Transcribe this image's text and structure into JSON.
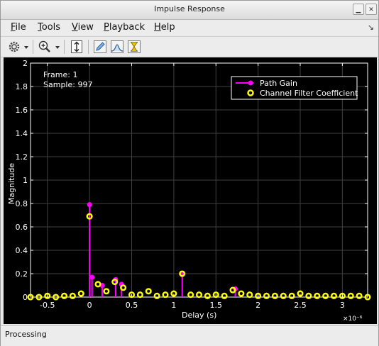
{
  "window": {
    "title": "Impulse Response",
    "minimize_icon": "minimize-icon",
    "close_icon": "close-icon"
  },
  "menubar": {
    "items": [
      {
        "label": "File",
        "mnemonic": "F",
        "rest": "ile"
      },
      {
        "label": "Tools",
        "mnemonic": "T",
        "rest": "ools"
      },
      {
        "label": "View",
        "mnemonic": "V",
        "rest": "iew"
      },
      {
        "label": "Playback",
        "mnemonic": "P",
        "rest": "layback"
      },
      {
        "label": "Help",
        "mnemonic": "H",
        "rest": "elp"
      }
    ],
    "dock_icon": "dock-arrow-icon"
  },
  "toolbar": {
    "icons": [
      "gear-icon",
      "dropdown-arrow-icon",
      "zoom-in-icon",
      "dropdown-arrow-icon",
      "scale-axes-icon",
      "edit-icon",
      "measure-peaks-icon",
      "cursor-measurements-icon"
    ]
  },
  "overlay": {
    "frame": "Frame: 1",
    "sample": "Sample: 997"
  },
  "status": {
    "text": "Processing"
  },
  "colors": {
    "background": "#000000",
    "axes": "#ffffff",
    "grid": "#404040",
    "path_gain": "#ff00ff",
    "filter_coeff": "#ffff00"
  },
  "chart_data": {
    "type": "scatter",
    "title": "",
    "xlabel": "Delay (s)",
    "ylabel": "Magnitude",
    "x_multiplier": "×10⁻⁶",
    "xlim": [
      -0.7,
      3.3
    ],
    "ylim": [
      0,
      2
    ],
    "xticks": [
      -0.5,
      0,
      0.5,
      1,
      1.5,
      2,
      2.5,
      3
    ],
    "xtick_labels": [
      "-0.5",
      "0",
      "0.5",
      "1",
      "1.5",
      "2",
      "2.5",
      "3"
    ],
    "yticks": [
      0,
      0.2,
      0.4,
      0.6,
      0.8,
      1,
      1.2,
      1.4,
      1.6,
      1.8,
      2
    ],
    "ytick_labels": [
      "0",
      "0.2",
      "0.4",
      "0.6",
      "0.8",
      "1",
      "1.2",
      "1.4",
      "1.6",
      "1.8",
      "2"
    ],
    "grid": true,
    "legend_position": "top-right",
    "series": [
      {
        "name": "Path Gain",
        "style": "stem",
        "color": "#ff00ff",
        "x": [
          0,
          0.03,
          0.15,
          0.31,
          0.38,
          1.1,
          1.73
        ],
        "y": [
          0.79,
          0.17,
          0.1,
          0.15,
          0.11,
          0.2,
          0.07
        ]
      },
      {
        "name": "Channel Filter Coefficient",
        "style": "marker",
        "color": "#ffff00",
        "x": [
          -0.7,
          -0.6,
          -0.5,
          -0.4,
          -0.3,
          -0.2,
          -0.1,
          0,
          0.1,
          0.2,
          0.3,
          0.4,
          0.5,
          0.6,
          0.7,
          0.8,
          0.9,
          1.0,
          1.1,
          1.2,
          1.3,
          1.4,
          1.5,
          1.6,
          1.7,
          1.8,
          1.9,
          2.0,
          2.1,
          2.2,
          2.3,
          2.4,
          2.5,
          2.6,
          2.7,
          2.8,
          2.9,
          3.0,
          3.1,
          3.2,
          3.3
        ],
        "y": [
          0.0,
          0.0,
          0.01,
          0.0,
          0.01,
          0.01,
          0.03,
          0.69,
          0.11,
          0.05,
          0.13,
          0.08,
          0.02,
          0.02,
          0.05,
          0.01,
          0.02,
          0.03,
          0.2,
          0.02,
          0.02,
          0.01,
          0.02,
          0.01,
          0.06,
          0.03,
          0.02,
          0.01,
          0.01,
          0.01,
          0.01,
          0.01,
          0.03,
          0.01,
          0.01,
          0.01,
          0.01,
          0.01,
          0.01,
          0.01,
          0.0
        ]
      }
    ]
  }
}
